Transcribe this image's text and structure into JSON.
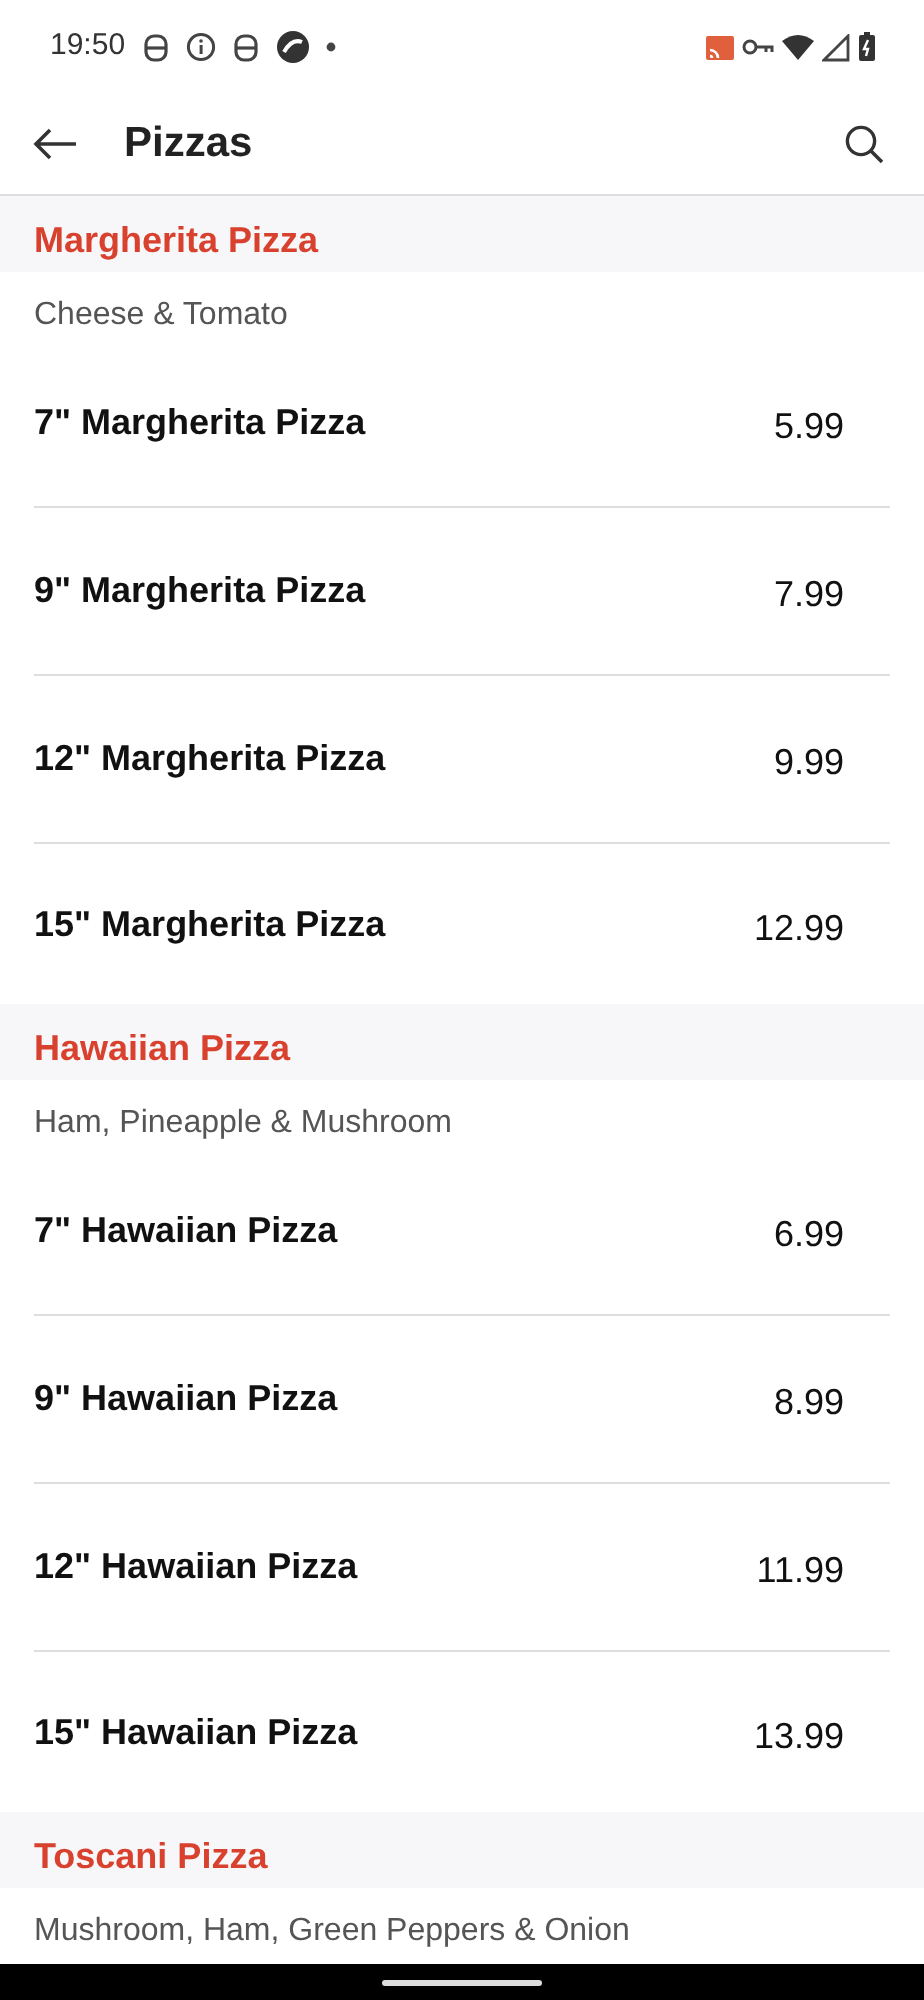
{
  "status_bar": {
    "time": "19:50"
  },
  "app_bar": {
    "title": "Pizzas"
  },
  "sections": [
    {
      "title": "Margherita Pizza",
      "description": "Cheese & Tomato",
      "items": [
        {
          "name": "7\" Margherita Pizza",
          "price": "5.99"
        },
        {
          "name": "9\" Margherita Pizza",
          "price": "7.99"
        },
        {
          "name": "12\" Margherita Pizza",
          "price": "9.99"
        },
        {
          "name": "15\" Margherita Pizza",
          "price": "12.99"
        }
      ]
    },
    {
      "title": "Hawaiian Pizza",
      "description": "Ham, Pineapple & Mushroom",
      "items": [
        {
          "name": "7\" Hawaiian Pizza",
          "price": "6.99"
        },
        {
          "name": "9\" Hawaiian Pizza",
          "price": "8.99"
        },
        {
          "name": "12\" Hawaiian Pizza",
          "price": "11.99"
        },
        {
          "name": "15\" Hawaiian Pizza",
          "price": "13.99"
        }
      ]
    },
    {
      "title": "Toscani Pizza",
      "description": "Mushroom, Ham, Green Peppers & Onion"
    }
  ]
}
